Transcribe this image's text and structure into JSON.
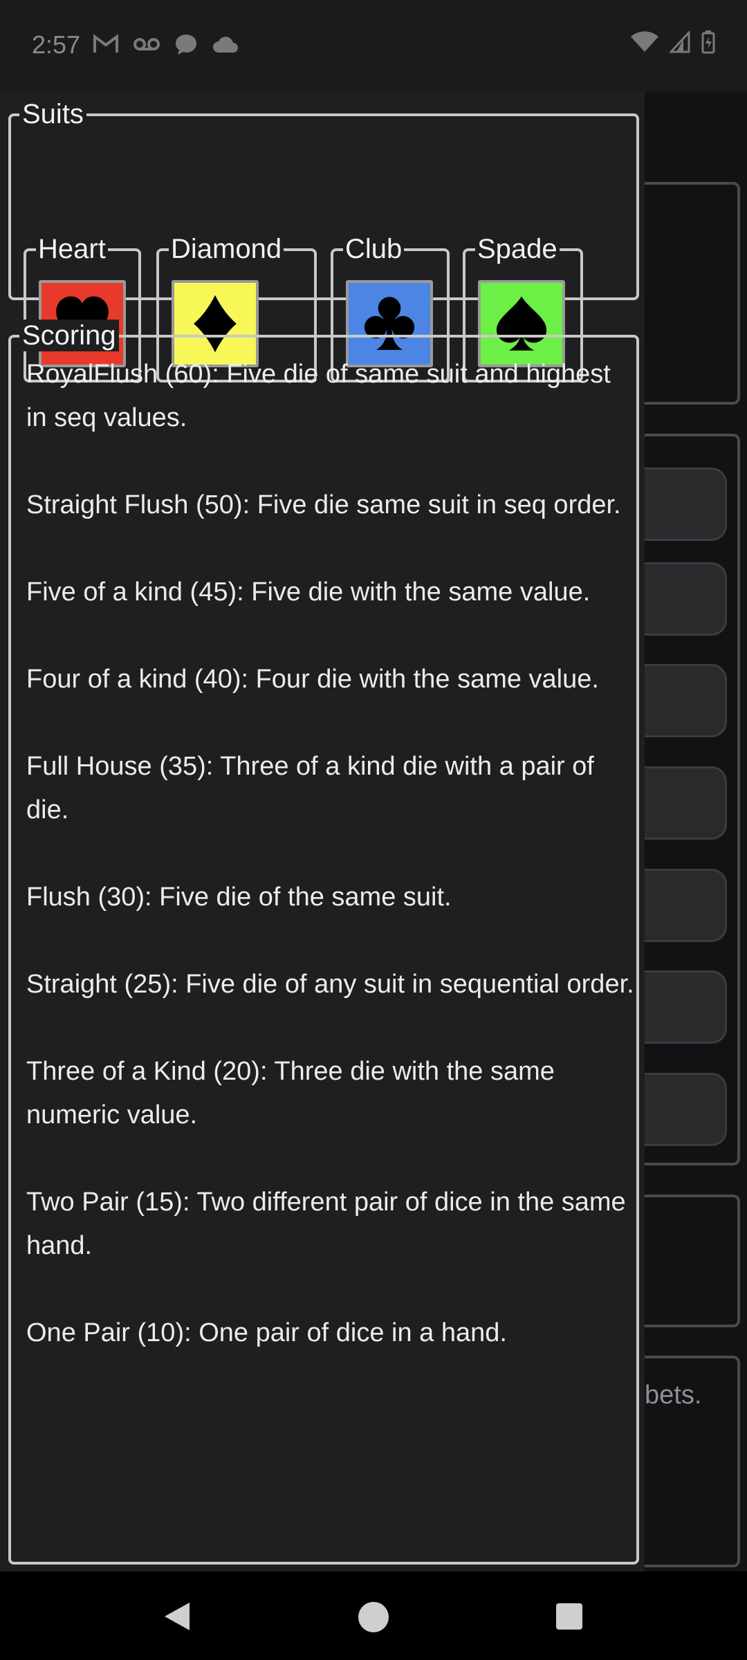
{
  "status_bar": {
    "time": "2:57",
    "left_icons": [
      "gmail-icon",
      "voicemail-icon",
      "messages-icon",
      "cloud-icon"
    ],
    "right_icons": [
      "wifi-icon",
      "signal-icon",
      "battery-icon"
    ]
  },
  "suits": {
    "title": "Suits",
    "items": [
      {
        "label": "Heart",
        "color": "#e83a2a",
        "icon": "heart-icon"
      },
      {
        "label": "Diamond",
        "color": "#f7f757",
        "icon": "diamond-icon"
      },
      {
        "label": "Club",
        "color": "#4d85e4",
        "icon": "club-icon"
      },
      {
        "label": "Spade",
        "color": "#6cf046",
        "icon": "spade-icon"
      }
    ]
  },
  "scoring": {
    "title": "Scoring",
    "rules": [
      "RoyalFlush (60): Five die of same suit and highest in seq values.",
      "Straight Flush (50): Five die same suit in seq order.",
      "Five of a kind (45): Five die with the same value.",
      "Four of a kind (40): Four die with the same value.",
      "Full House (35): Three of a kind die with a pair of die.",
      "Flush (30): Five die of the same suit.",
      "Straight (25): Five die of any suit in sequential order.",
      "Three of a Kind (20): Three die with the same numeric value.",
      "Two Pair (15): Two different pair of dice in the same hand.",
      "One Pair (10): One pair of dice in a hand."
    ]
  },
  "background": {
    "partial_text": "bets."
  },
  "nav_bar": {
    "icons": [
      "back-icon",
      "home-icon",
      "recents-icon"
    ]
  }
}
